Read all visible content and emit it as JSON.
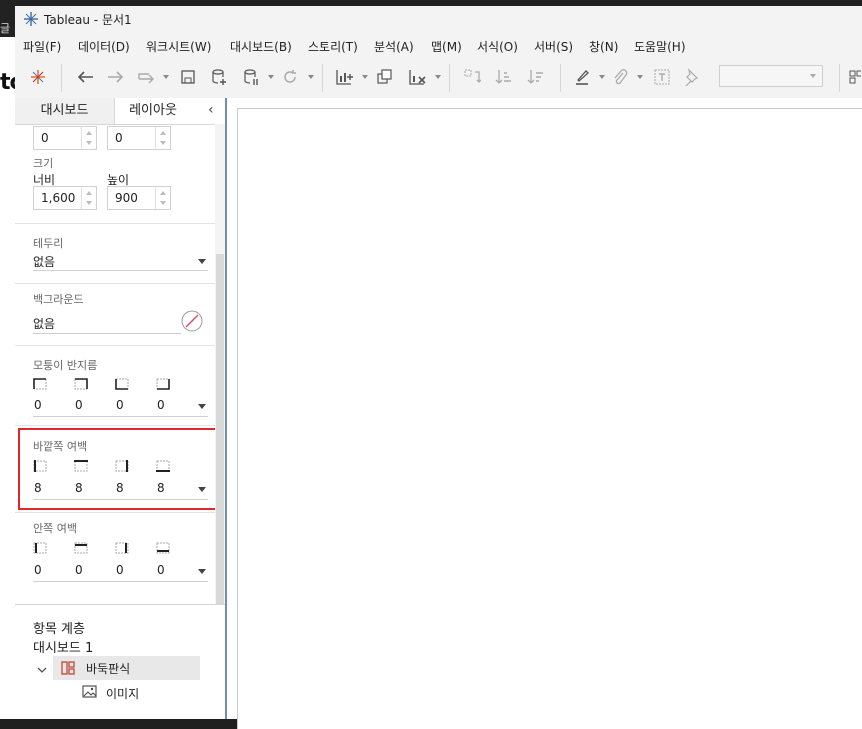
{
  "window": {
    "title": "Tableau - 문서1"
  },
  "edge": {
    "glyph": "글",
    "logo_fragment": "tc"
  },
  "menu": [
    "파일(F)",
    "데이터(D)",
    "워크시트(W)",
    "대시보드(B)",
    "스토리(T)",
    "분석(A)",
    "맵(M)",
    "서식(O)",
    "서버(S)",
    "창(N)",
    "도움말(H)"
  ],
  "tabs": {
    "dashboard": "대시보드",
    "layout": "레이아웃"
  },
  "position": {
    "x": "0",
    "y": "0"
  },
  "size": {
    "label": "크기",
    "width_label": "너비",
    "width_value": "1,600",
    "height_label": "높이",
    "height_value": "900"
  },
  "border": {
    "label": "테두리",
    "value": "없음"
  },
  "background": {
    "label": "백그라운드",
    "value": "없음"
  },
  "corner_radius": {
    "label": "모퉁이 반지름",
    "values": [
      "0",
      "0",
      "0",
      "0"
    ]
  },
  "outer_padding": {
    "label": "바깥쪽 여백",
    "values": [
      "8",
      "8",
      "8",
      "8"
    ]
  },
  "inner_padding": {
    "label": "안쪽 여백",
    "values": [
      "0",
      "0",
      "0",
      "0"
    ]
  },
  "hierarchy": {
    "title": "항목 계층",
    "root": "대시보드 1",
    "tiled": "바둑판식",
    "image": "이미지"
  },
  "colors": {
    "highlight": "#e0282e",
    "divider": "#6f8db0",
    "tiled_icon": "#c0392b"
  },
  "icons": [
    "tableau-logo-icon",
    "back-icon",
    "forward-icon",
    "redo-icon",
    "save-icon",
    "new-datasource-icon",
    "pause-updates-icon",
    "refresh-icon",
    "new-worksheet-icon",
    "duplicate-icon",
    "clear-icon",
    "swap-icon",
    "sort-asc-icon",
    "sort-desc-icon",
    "highlight-icon",
    "attach-icon",
    "label-icon",
    "pin-icon",
    "show-me-icon"
  ]
}
